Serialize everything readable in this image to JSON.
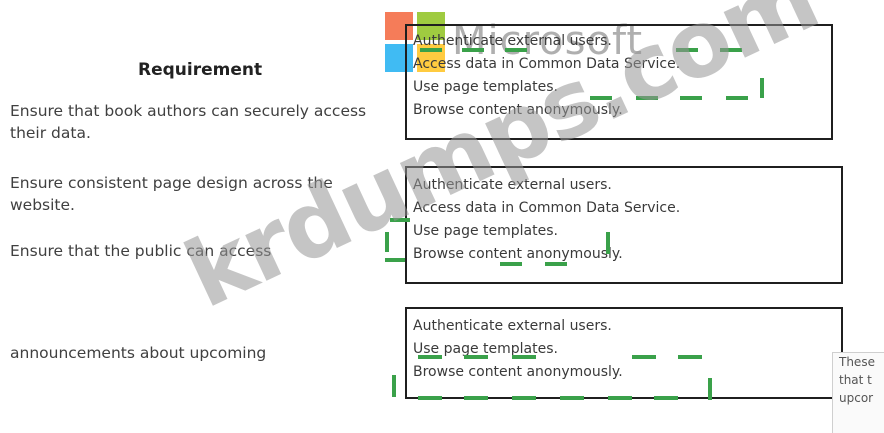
{
  "requirement_header": "Requirement",
  "requirements": [
    "Ensure that book authors can securely access their data.",
    "Ensure consistent page design across the website.",
    "Ensure that the public can access",
    "announcements about upcoming"
  ],
  "dropdowns": [
    {
      "options": [
        "Authenticate external users.",
        "Access data in Common Data Service.",
        "Use page templates.",
        "Browse content anonymously."
      ]
    },
    {
      "options": [
        "Authenticate external users.",
        "Access data in Common Data Service.",
        "Use page templates.",
        "Browse content anonymously."
      ]
    },
    {
      "options": [
        "Authenticate external users.",
        "Use page templates.",
        "Browse content anonymously."
      ]
    }
  ],
  "side_panel_lines": [
    "These",
    "that t",
    "upcor"
  ],
  "watermark_text": "krdumps.com",
  "logo_text": "Microsoft",
  "colors": {
    "accent_green": "#3aa14a",
    "logo_red": "#f25022",
    "logo_green": "#7fba00",
    "logo_blue": "#00a4ef",
    "logo_yellow": "#ffb900"
  }
}
